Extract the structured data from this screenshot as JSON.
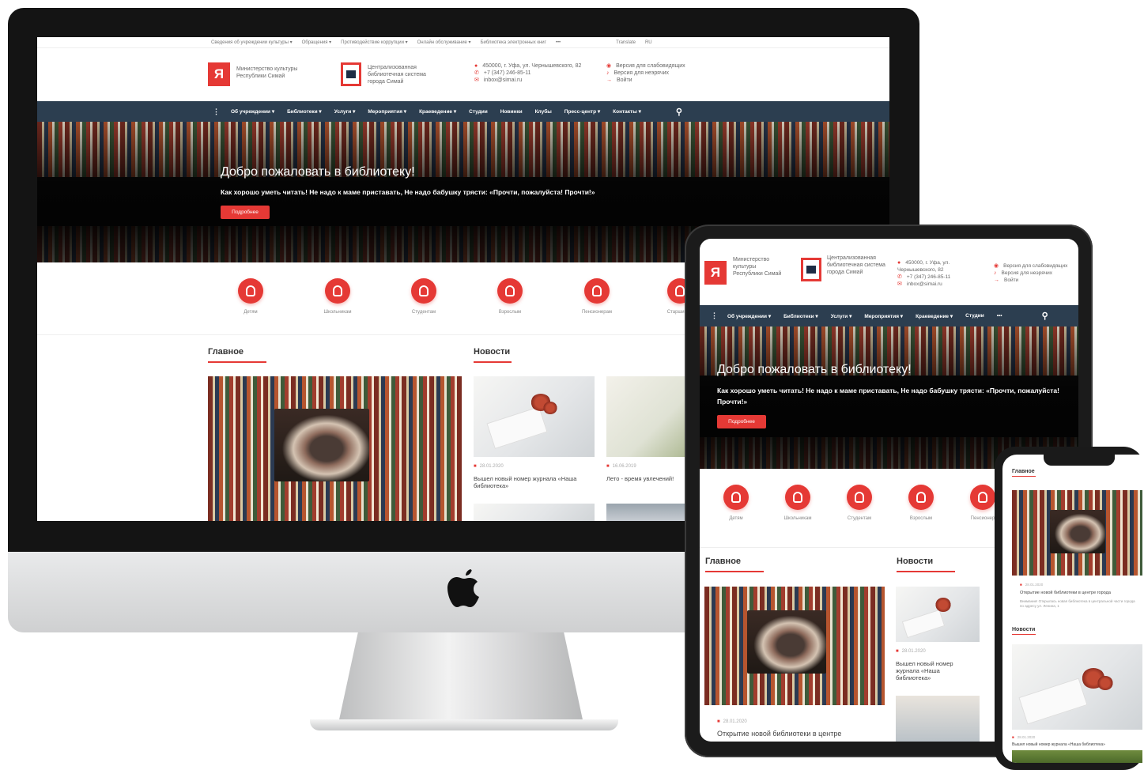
{
  "site": {
    "topbar": [
      "Сведения об учреждении культуры ▾",
      "Обращения ▾",
      "Противодействие коррупции ▾",
      "Онлайн обслуживание ▾",
      "Библиотека электронных книг",
      "•••"
    ],
    "translate": "Translate",
    "lang": "RU",
    "ministry": "Министерство культуры Республики Симай",
    "cbs": "Централизованная библиотечная система города Симай",
    "address": "450000, г. Уфа, ул. Чернышевского, 82",
    "phone": "+7 (347) 246-85-11",
    "email": "inbox@simai.ru",
    "access_low_vision": "Версия для слабовидящих",
    "access_deaf": "Версия для неэрячих",
    "login": "Войти",
    "nav": [
      "Об учреждении ▾",
      "Библиотеки ▾",
      "Услуги ▾",
      "Мероприятия ▾",
      "Краеведение ▾",
      "Студии",
      "Новинки",
      "Клубы",
      "Пресс-центр ▾",
      "Контакты ▾"
    ],
    "hero_title": "Добро пожаловать в библиотеку!",
    "hero_sub": "Как хорошо уметь читать! Не надо к маме приставать, Не надо бабушку трясти: «Прочти, пожалуйста! Прочти!»",
    "hero_btn": "Подробнее",
    "audience": [
      "Детям",
      "Школьникам",
      "Студентам",
      "Взрослым",
      "Пенсионерам",
      "Старшим ш"
    ],
    "main_title": "Главное",
    "news_title": "Новости",
    "news": [
      {
        "date": "28.01.2020",
        "title": "Вышел новый номер журнала «Наша библиотека»"
      },
      {
        "date": "16.06.2019",
        "title": "Лето - время увлечений!"
      }
    ]
  },
  "tablet": {
    "ministry": "Министерство культуры Республики Симай",
    "address": "450000, г. Уфа, ул. Чернышевского, 82",
    "nav": [
      "Об учреждении ▾",
      "Библиотеки ▾",
      "Услуги ▾",
      "Мероприятия ▾",
      "Краеведение ▾",
      "Студии",
      "•••"
    ],
    "hero_sub": "Как хорошо уметь читать! Не надо к маме приставать, Не надо бабушку трясти: «Прочти, пожалуйста! Прочти!»",
    "audience": [
      "Детям",
      "Школьникам",
      "Студентам",
      "Взрослым",
      "Пенсионер"
    ],
    "main_date": "28.01.2020",
    "main_news": "Открытие новой библиотеки в центре",
    "news_title_text": "Вышел новый номер журнала «Наша библиотека»"
  },
  "phone": {
    "main_title": "Главное",
    "main_date": "28.01.2020",
    "main_news": "Открытие новой библиотеки в центре города",
    "main_desc": "Внимание! Открылась новая библиотека в центральной части города по адресу ул. Ленина, 1",
    "news_title": "Новости",
    "news_date": "28.01.2020",
    "news_text": "Вышел новый номер журнала «Наша библиотека»"
  },
  "colors": {
    "accent": "#e53935",
    "nav": "#2c3e50"
  },
  "icons": [
    "apple-logo-icon",
    "search-icon",
    "location-icon",
    "phone-icon",
    "mail-icon",
    "eye-icon",
    "ear-icon",
    "login-icon",
    "book-logo-icon"
  ]
}
